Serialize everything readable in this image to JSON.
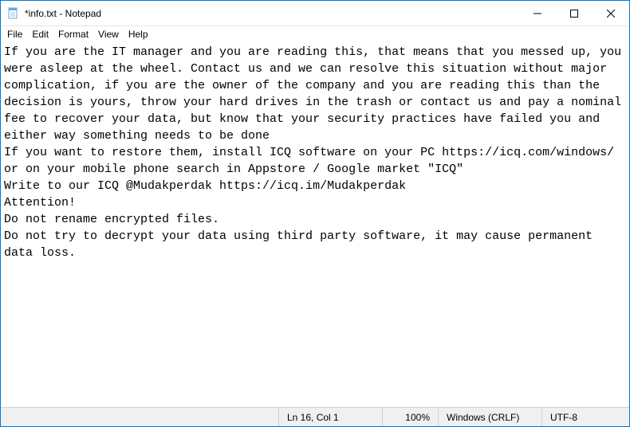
{
  "window": {
    "title": "*info.txt - Notepad"
  },
  "menu": {
    "file": "File",
    "edit": "Edit",
    "format": "Format",
    "view": "View",
    "help": "Help"
  },
  "content": "If you are the IT manager and you are reading this, that means that you messed up, you were asleep at the wheel. Contact us and we can resolve this situation without major complication, if you are the owner of the company and you are reading this than the decision is yours, throw your hard drives in the trash or contact us and pay a nominal fee to recover your data, but know that your security practices have failed you and either way something needs to be done\nIf you want to restore them, install ICQ software on your PC https://icq.com/windows/ or on your mobile phone search in Appstore / Google market \"ICQ\"\nWrite to our ICQ @Mudakperdak https://icq.im/Mudakperdak\nAttention!\nDo not rename encrypted files.\nDo not try to decrypt your data using third party software, it may cause permanent data loss.",
  "status": {
    "position": "Ln 16, Col 1",
    "zoom": "100%",
    "eol": "Windows (CRLF)",
    "encoding": "UTF-8"
  }
}
